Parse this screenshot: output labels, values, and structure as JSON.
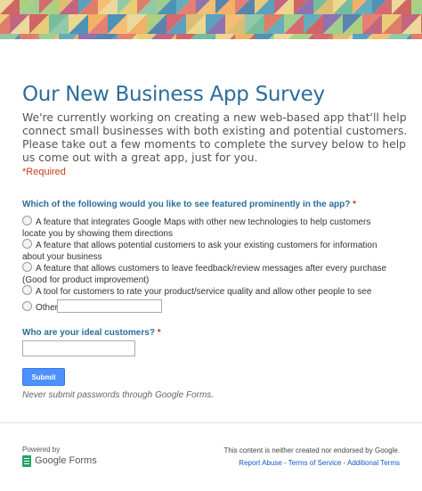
{
  "header": {
    "banner_colors": [
      "#e8d28b",
      "#d7b25a",
      "#7fbf9a",
      "#4b9fb0",
      "#e06a5a",
      "#c94a4a",
      "#f0a34a",
      "#9dc86a",
      "#3f8fb4",
      "#d9664f",
      "#7a5aa0",
      "#e4c45e",
      "#5fb08a",
      "#2f7fa8",
      "#cf4f58",
      "#f2b45c",
      "#8fc67a",
      "#3b6fa0",
      "#b84a6a",
      "#e9d07a"
    ]
  },
  "form": {
    "title": "Our New Business App Survey",
    "description": "We're currently working on creating a new web-based app that'll help connect small businesses with both existing and potential customers. Please take out a few moments to complete the survey below to help us come out with a great app, just for you.",
    "required_note": "*Required",
    "question1": {
      "title": "Which of the following would you like to see featured prominently in the app?",
      "required_mark": "*",
      "options": [
        "A feature that integrates Google Maps with other new technologies to help customers locate you by showing them directions",
        "A feature that allows potential customers to ask your existing customers for information about your business",
        "A feature that allows customers to leave feedback/review messages after every purchase (Good for product improvement)",
        "A tool for customers to rate your product/service quality and allow other people to see",
        "Other:"
      ],
      "other_value": ""
    },
    "question2": {
      "title": "Who are your ideal customers?",
      "required_mark": "*",
      "value": ""
    },
    "submit_label": "Submit",
    "password_warning": "Never submit passwords through Google Forms."
  },
  "footer": {
    "powered_by": "Powered by",
    "logo_text": "Google Forms",
    "disclaimer": "This content is neither created nor endorsed by Google.",
    "links": [
      "Report Abuse",
      "Terms of Service",
      "Additional Terms"
    ],
    "separator": " - "
  }
}
